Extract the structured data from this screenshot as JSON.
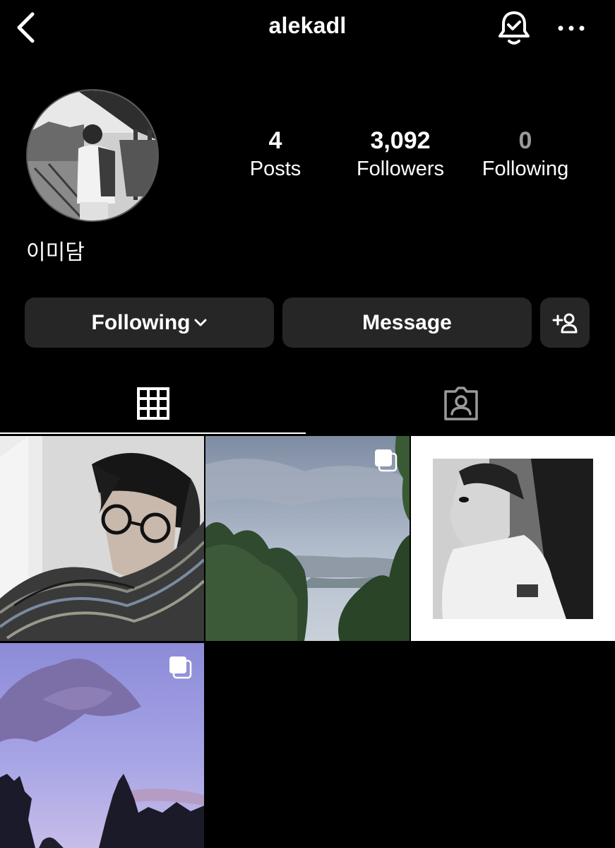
{
  "header": {
    "username": "alekadl",
    "back_icon": "chevron-left-icon",
    "bell_icon": "bell-check-icon",
    "more_icon": "ellipsis-icon"
  },
  "profile": {
    "display_name": "이미담",
    "stats": {
      "posts_count": "4",
      "posts_label": "Posts",
      "followers_count": "3,092",
      "followers_label": "Followers",
      "following_count": "0",
      "following_label": "Following"
    }
  },
  "actions": {
    "following_label": "Following",
    "message_label": "Message",
    "add_user_icon": "add-person-icon"
  },
  "tabs": {
    "grid_icon": "grid-icon",
    "tagged_icon": "tagged-person-icon",
    "active": "grid"
  },
  "posts": [
    {
      "type": "photo",
      "multiple": false
    },
    {
      "type": "photo",
      "multiple": true
    },
    {
      "type": "photo",
      "multiple": false
    },
    {
      "type": "photo",
      "multiple": true
    }
  ],
  "colors": {
    "background": "#000000",
    "button_bg": "#262626",
    "text": "#ffffff",
    "dim_text": "#9a9a9a"
  }
}
